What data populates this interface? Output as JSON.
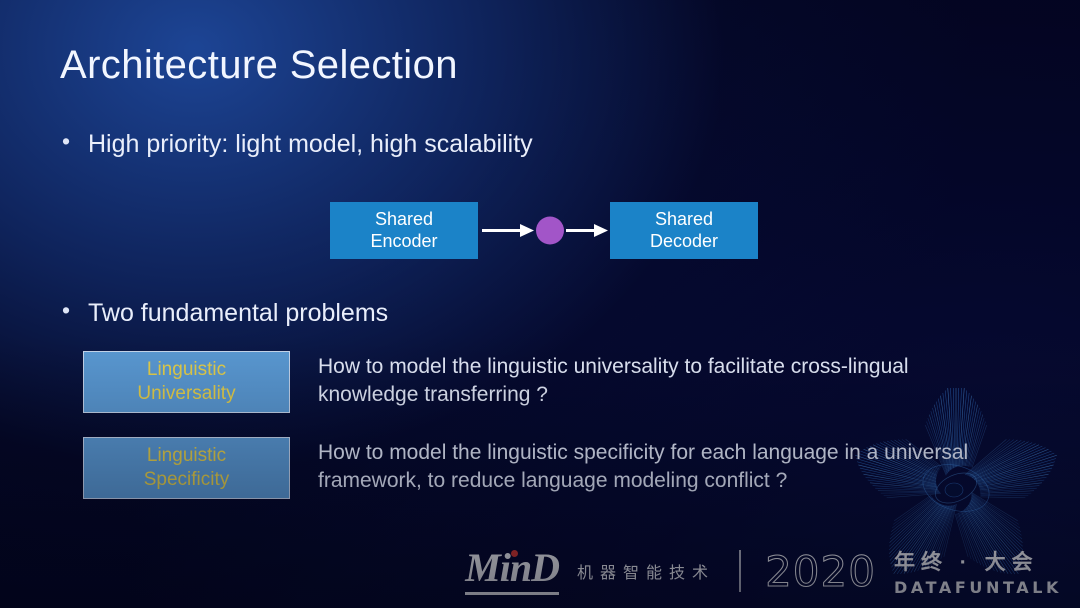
{
  "slide": {
    "title": "Architecture Selection",
    "bullets": [
      {
        "marker": "•",
        "text": "High priority: light model, high scalability"
      },
      {
        "marker": "•",
        "text": "Two fundamental problems"
      }
    ],
    "diagram": {
      "encoder_line1": "Shared",
      "encoder_line2": "Encoder",
      "decoder_line1": "Shared",
      "decoder_line2": "Decoder",
      "node_color": "#a255c8",
      "box_color": "#1b83c8",
      "arrow_color": "#ffffff"
    },
    "problems": [
      {
        "tag_line1": "Linguistic",
        "tag_line2": "Universality",
        "description": "How to model the linguistic universality to facilitate cross-lingual knowledge transferring ?"
      },
      {
        "tag_line1": "Linguistic",
        "tag_line2": "Specificity",
        "description": "How to model the linguistic specificity for each language in a universal framework, to reduce language modeling conflict ?"
      }
    ],
    "colors": {
      "tag_background": "#5b9bd5",
      "tag_text": "#e8d24a",
      "body_text": "#e6ecfb",
      "background_top_left": "#17326d",
      "background_bottom_right": "#03041f"
    }
  },
  "footer": {
    "logo_text": "MinD",
    "cn_tagline": "机器智能技术",
    "year": "2020",
    "cn_event": "年终 · 大会",
    "brand": "DATAFUNTALK"
  }
}
